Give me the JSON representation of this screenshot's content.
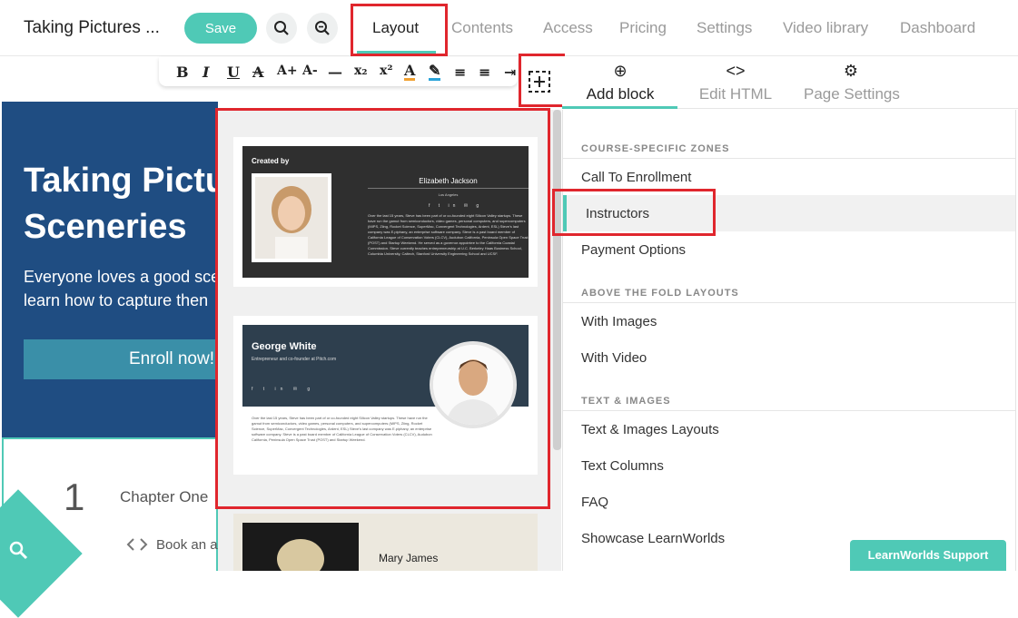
{
  "header": {
    "course_title": "Taking Pictures ...",
    "save_label": "Save",
    "tabs": [
      "Layout",
      "Contents",
      "Access",
      "Pricing",
      "Settings",
      "Video library",
      "Dashboard"
    ]
  },
  "formatting": {
    "buttons": [
      "B",
      "I",
      "U",
      "A",
      "A+",
      "A-",
      "—",
      "x₂",
      "x²",
      "A",
      "✎",
      "≡",
      "≡",
      "⇥"
    ]
  },
  "course_page": {
    "hero_title": "Taking Pictures of Sceneries",
    "hero_title_line1": "Taking Pictu",
    "hero_title_line2": "Sceneries",
    "hero_sub_line1": "Everyone loves a good sce",
    "hero_sub_line2": "learn how to capture then",
    "enroll_label": "Enroll now!",
    "chapter_number": "1",
    "chapter_title": "Chapter One",
    "chapter_item": "Book an ap"
  },
  "preview": {
    "card1_created_by": "Created by",
    "card1_name": "Elizabeth Jackson",
    "card1_location": "Los Angeles",
    "card1_bio": "Over the last 15 years, Steve has been part of or co-founded eight Silicon Valley startups. These have run the gamut from semiconductors, video games, personal computers, and supercomputers (MIPS, Ziing, Rocket Science, SuperMac, Convergent Technologies, Ardent, ESL) Steve's last company was E.piphany, an enterprise software company. Steve is a past board member of California League of Conservation Voters (CLCV), Audubon California, Peninsula Open Space Trust (POST) and Startup Weekend. He served as a governor appointee to the California Coastal Commission. Steve currently teaches entrepreneurship at U.C. Berkeley Haas Business School, Columbia University, Caltech, Stanford University Engineering School and UCSF.",
    "card2_name": "George White",
    "card2_role": "Entrepreneur and co-founder at Pitch.com",
    "card2_bio": "Over the last 15 years, Steve has been part of or co-founded eight Silicon Valley startups. These have run the gamut from semiconductors, video games, personal computers, and supercomputers (MIPS, Ziing, Rocket Science, SuperMac, Convergent Technologies, Ardent, ESL) Steve's last company was E.piphany, an enterprise software company. Steve is a past board member of California League of Conservation Voters (CLCV), Audubon California, Peninsula Open Space Trust (POST) and Startup Weekend.",
    "card3_name": "Mary James"
  },
  "side_panel": {
    "tabs": [
      {
        "icon": "⊕",
        "label": "Add block"
      },
      {
        "icon": "<>",
        "label": "Edit HTML"
      },
      {
        "icon": "⚙",
        "label": "Page Settings"
      }
    ],
    "sections": [
      {
        "heading": "COURSE-SPECIFIC ZONES",
        "items": [
          "Call To Enrollment",
          "Instructors",
          "Payment Options"
        ]
      },
      {
        "heading": "ABOVE THE FOLD LAYOUTS",
        "items": [
          "With Images",
          "With Video"
        ]
      },
      {
        "heading": "TEXT & IMAGES",
        "items": [
          "Text & Images Layouts",
          "Text Columns",
          "FAQ",
          "Showcase LearnWorlds"
        ]
      }
    ]
  },
  "support_label": "LearnWorlds Support",
  "colors": {
    "accent": "#4fc9b6",
    "hero_bg": "#1f4d82",
    "highlight_red": "#e0262d"
  }
}
